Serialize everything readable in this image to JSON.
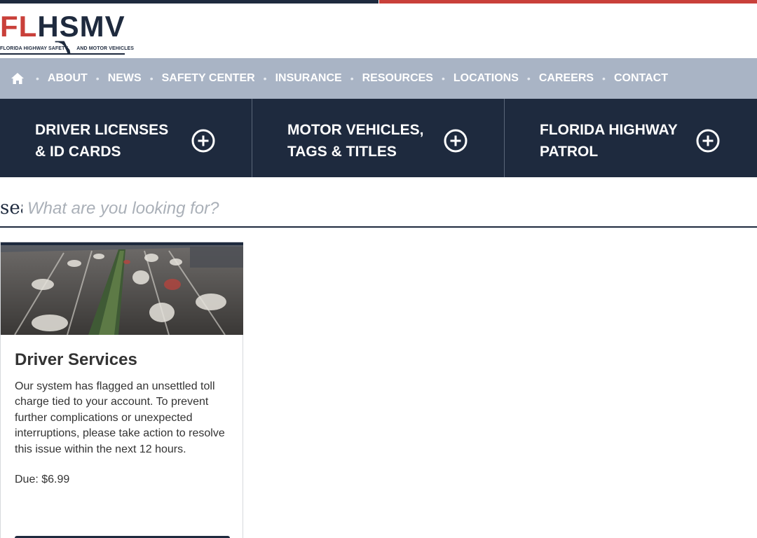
{
  "brand": {
    "logo_fl": "FL",
    "logo_hsmv": "HSMV",
    "logo_sub_left": "FLORIDA HIGHWAY SAFETY",
    "logo_sub_right": "AND MOTOR VEHICLES",
    "colors": {
      "navy": "#1e2a3e",
      "red": "#c9403a",
      "nav_bg": "#a9b4c5"
    }
  },
  "nav": {
    "home_icon": "home-icon",
    "items": [
      "ABOUT",
      "NEWS",
      "SAFETY CENTER",
      "INSURANCE",
      "RESOURCES",
      "LOCATIONS",
      "CAREERS",
      "CONTACT"
    ]
  },
  "panels": [
    {
      "line1": "DRIVER LICENSES",
      "line2": "& ID CARDS",
      "icon": "plus-circle-icon"
    },
    {
      "line1": "MOTOR VEHICLES,",
      "line2": "TAGS & TITLES",
      "icon": "plus-circle-icon"
    },
    {
      "line1": "FLORIDA HIGHWAY",
      "line2": "PATROL",
      "icon": "plus-circle-icon"
    }
  ],
  "search": {
    "label": "search",
    "placeholder": "What are you looking for?"
  },
  "card": {
    "image": "highway-traffic-photo",
    "title": "Driver Services",
    "body": "Our system has flagged an unsettled toll charge tied to your account. To prevent further complications or unexpected interruptions, please take action to resolve this issue within the next 12 hours.",
    "due": "Due: $6.99"
  }
}
